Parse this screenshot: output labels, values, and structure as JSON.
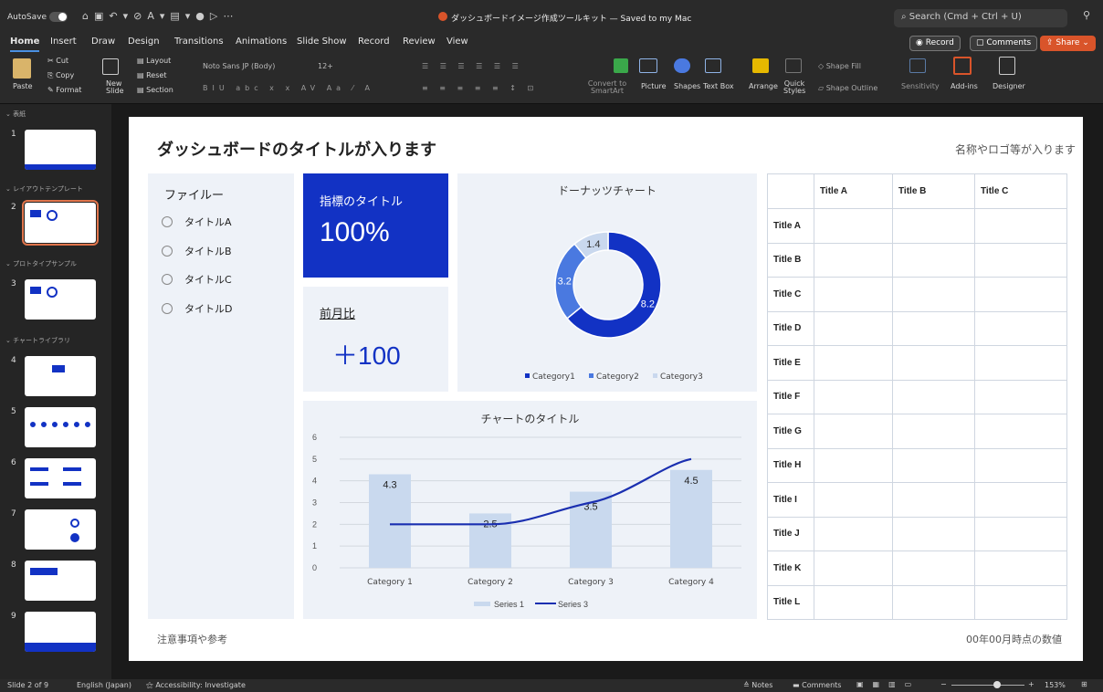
{
  "titlebar": {
    "autosave": "AutoSave",
    "doc_title": "ダッシュボードイメージ作成ツールキット — Saved to my Mac",
    "search": "Search (Cmd + Ctrl + U)"
  },
  "tabs": [
    "Home",
    "Insert",
    "Draw",
    "Design",
    "Transitions",
    "Animations",
    "Slide Show",
    "Record",
    "Review",
    "View"
  ],
  "pills": {
    "record": "Record",
    "comments": "Comments",
    "share": "Share"
  },
  "toolbar": {
    "paste": "Paste",
    "cut": "Cut",
    "copy": "Copy",
    "format": "Format",
    "new_slide": "New Slide",
    "layout": "Layout",
    "reset": "Reset",
    "section": "Section",
    "font": "Noto Sans JP (Body)",
    "size": "12+",
    "convert": "Convert to SmartArt",
    "picture": "Picture",
    "shapes": "Shapes",
    "textbox": "Text Box",
    "arrange": "Arrange",
    "quick_styles": "Quick Styles",
    "shape_fill": "Shape Fill",
    "shape_outline": "Shape Outline",
    "sensitivity": "Sensitivity",
    "addins": "Add-ins",
    "designer": "Designer"
  },
  "panel": {
    "sec1": "表紙",
    "sec2": "レイアウトテンプレート",
    "sec3": "プロトタイプサンプル",
    "sec4": "チャートライブラリ",
    "slides": [
      "1",
      "2",
      "3",
      "4",
      "5",
      "6",
      "7",
      "8",
      "9"
    ]
  },
  "slide": {
    "title": "ダッシュボードのタイトルが入ります",
    "logo": "名称やロゴ等が入ります",
    "filter_title": "ファイルー",
    "filters": [
      "タイトルA",
      "タイトルB",
      "タイトルC",
      "タイトルD"
    ],
    "kpi_title": "指標のタイトル",
    "kpi_value": "100%",
    "mom_title": "前月比",
    "mom_value": "＋100",
    "footer_left": "注意事項や参考",
    "footer_right": "00年00月時点の数値",
    "table": {
      "headers": [
        "Title A",
        "Title B",
        "Title C"
      ],
      "rows": [
        "Title A",
        "Title B",
        "Title C",
        "Title D",
        "Title E",
        "Title F",
        "Title G",
        "Title H",
        "Title I",
        "Title J",
        "Title K",
        "Title L"
      ]
    }
  },
  "status": {
    "slide": "Slide 2 of 9",
    "lang": "English (Japan)",
    "access": "Accessibility: Investigate",
    "notes": "Notes",
    "comments": "Comments",
    "zoom": "153%"
  },
  "chart_data": [
    {
      "type": "pie",
      "title": "ドーナッツチャート",
      "categories": [
        "Category1",
        "Category2",
        "Category3"
      ],
      "values": [
        8.2,
        3.2,
        1.4
      ],
      "colors": [
        "#1232c4",
        "#4a79e0",
        "#c9d8ee"
      ],
      "legend": "bottom"
    },
    {
      "type": "bar",
      "title": "チャートのタイトル",
      "categories": [
        "Category 1",
        "Category 2",
        "Category 3",
        "Category 4"
      ],
      "series": [
        {
          "name": "Series 1",
          "type": "bar",
          "values": [
            4.3,
            2.5,
            3.5,
            4.5
          ]
        },
        {
          "name": "Series 3",
          "type": "line",
          "values": [
            2,
            2,
            3,
            5
          ]
        }
      ],
      "ylim": [
        0,
        6
      ],
      "yticks": [
        "0",
        "1",
        "2",
        "3",
        "4",
        "5",
        "6"
      ],
      "legend": "bottom",
      "grid": true
    }
  ]
}
